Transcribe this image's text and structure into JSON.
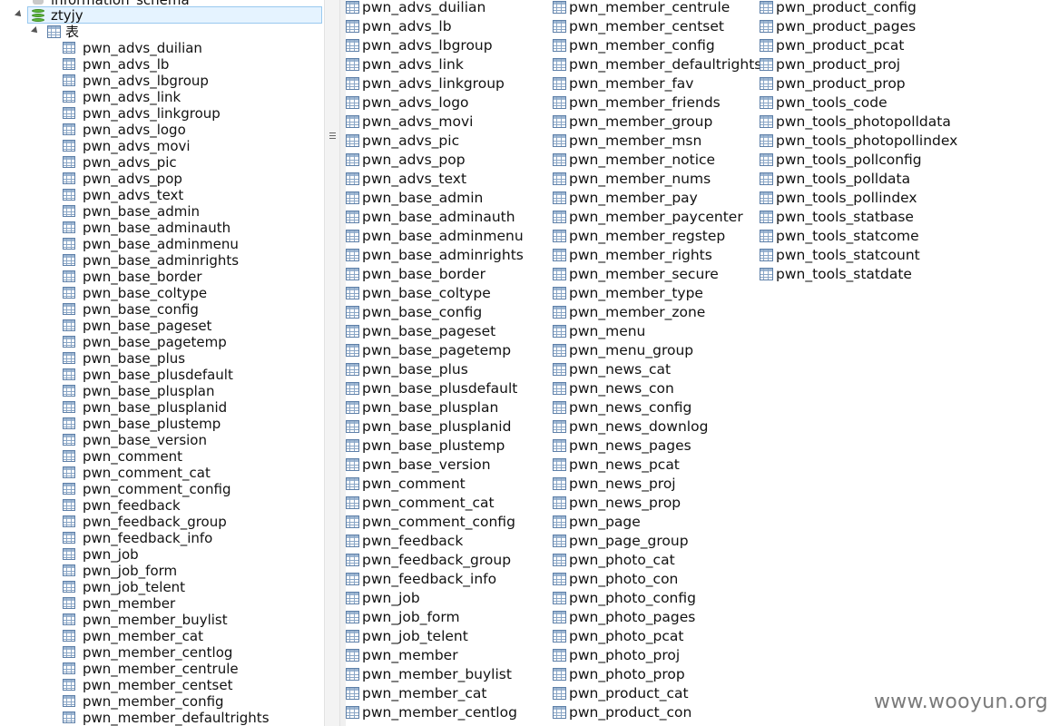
{
  "sidebar": {
    "above_node": "information_schema",
    "db_node": "ztyjy",
    "folder_node": "表",
    "tables": [
      "pwn_advs_duilian",
      "pwn_advs_lb",
      "pwn_advs_lbgroup",
      "pwn_advs_link",
      "pwn_advs_linkgroup",
      "pwn_advs_logo",
      "pwn_advs_movi",
      "pwn_advs_pic",
      "pwn_advs_pop",
      "pwn_advs_text",
      "pwn_base_admin",
      "pwn_base_adminauth",
      "pwn_base_adminmenu",
      "pwn_base_adminrights",
      "pwn_base_border",
      "pwn_base_coltype",
      "pwn_base_config",
      "pwn_base_pageset",
      "pwn_base_pagetemp",
      "pwn_base_plus",
      "pwn_base_plusdefault",
      "pwn_base_plusplan",
      "pwn_base_plusplanid",
      "pwn_base_plustemp",
      "pwn_base_version",
      "pwn_comment",
      "pwn_comment_cat",
      "pwn_comment_config",
      "pwn_feedback",
      "pwn_feedback_group",
      "pwn_feedback_info",
      "pwn_job",
      "pwn_job_form",
      "pwn_job_telent",
      "pwn_member",
      "pwn_member_buylist",
      "pwn_member_cat",
      "pwn_member_centlog",
      "pwn_member_centrule",
      "pwn_member_centset",
      "pwn_member_config",
      "pwn_member_defaultrights"
    ]
  },
  "main": {
    "columns": [
      [
        "pwn_advs_duilian",
        "pwn_advs_lb",
        "pwn_advs_lbgroup",
        "pwn_advs_link",
        "pwn_advs_linkgroup",
        "pwn_advs_logo",
        "pwn_advs_movi",
        "pwn_advs_pic",
        "pwn_advs_pop",
        "pwn_advs_text",
        "pwn_base_admin",
        "pwn_base_adminauth",
        "pwn_base_adminmenu",
        "pwn_base_adminrights",
        "pwn_base_border",
        "pwn_base_coltype",
        "pwn_base_config",
        "pwn_base_pageset",
        "pwn_base_pagetemp",
        "pwn_base_plus",
        "pwn_base_plusdefault",
        "pwn_base_plusplan",
        "pwn_base_plusplanid",
        "pwn_base_plustemp",
        "pwn_base_version",
        "pwn_comment",
        "pwn_comment_cat",
        "pwn_comment_config",
        "pwn_feedback",
        "pwn_feedback_group",
        "pwn_feedback_info",
        "pwn_job",
        "pwn_job_form",
        "pwn_job_telent",
        "pwn_member",
        "pwn_member_buylist",
        "pwn_member_cat",
        "pwn_member_centlog"
      ],
      [
        "pwn_member_centrule",
        "pwn_member_centset",
        "pwn_member_config",
        "pwn_member_defaultrights",
        "pwn_member_fav",
        "pwn_member_friends",
        "pwn_member_group",
        "pwn_member_msn",
        "pwn_member_notice",
        "pwn_member_nums",
        "pwn_member_pay",
        "pwn_member_paycenter",
        "pwn_member_regstep",
        "pwn_member_rights",
        "pwn_member_secure",
        "pwn_member_type",
        "pwn_member_zone",
        "pwn_menu",
        "pwn_menu_group",
        "pwn_news_cat",
        "pwn_news_con",
        "pwn_news_config",
        "pwn_news_downlog",
        "pwn_news_pages",
        "pwn_news_pcat",
        "pwn_news_proj",
        "pwn_news_prop",
        "pwn_page",
        "pwn_page_group",
        "pwn_photo_cat",
        "pwn_photo_con",
        "pwn_photo_config",
        "pwn_photo_pages",
        "pwn_photo_pcat",
        "pwn_photo_proj",
        "pwn_photo_prop",
        "pwn_product_cat",
        "pwn_product_con"
      ],
      [
        "pwn_product_config",
        "pwn_product_pages",
        "pwn_product_pcat",
        "pwn_product_proj",
        "pwn_product_prop",
        "pwn_tools_code",
        "pwn_tools_photopolldata",
        "pwn_tools_photopollindex",
        "pwn_tools_pollconfig",
        "pwn_tools_polldata",
        "pwn_tools_pollindex",
        "pwn_tools_statbase",
        "pwn_tools_statcome",
        "pwn_tools_statcount",
        "pwn_tools_statdate"
      ]
    ]
  },
  "watermark": "www.wooyun.org",
  "colors": {
    "selection": "#e5f3ff",
    "selection_border": "#99c9ef",
    "db_icon": "#5bb53a",
    "table_icon": "#5d7fa8"
  }
}
